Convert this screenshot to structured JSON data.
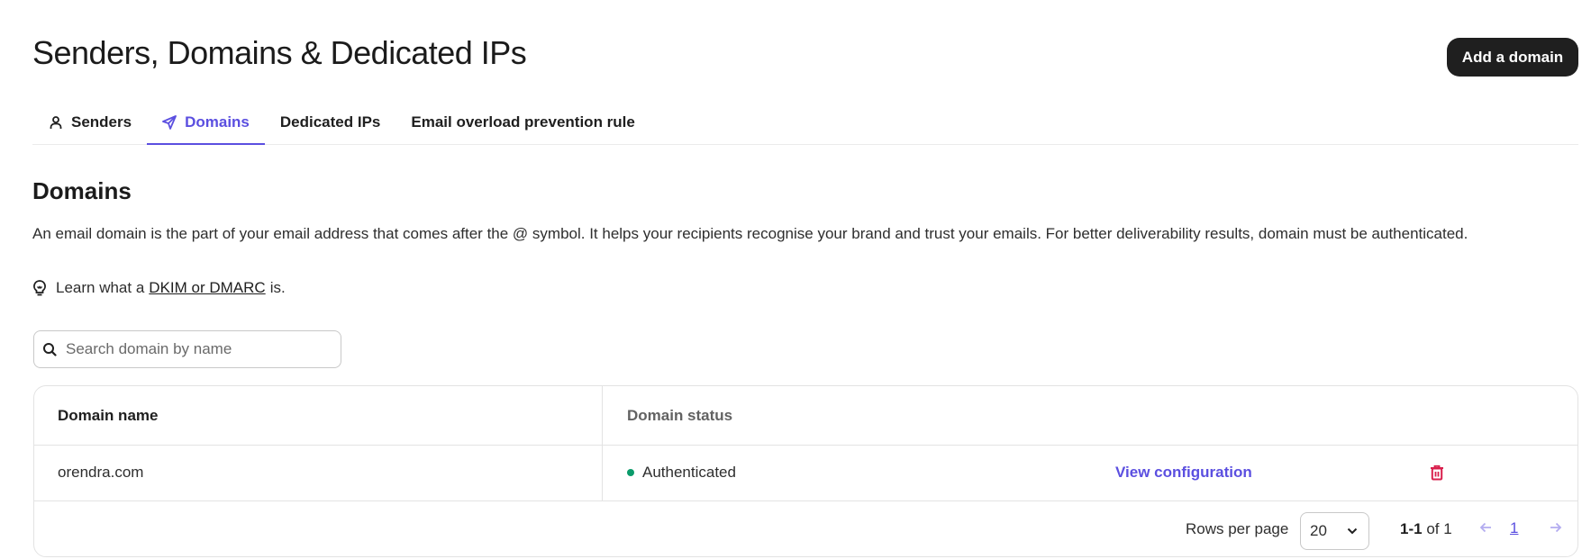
{
  "header": {
    "title": "Senders, Domains & Dedicated IPs",
    "add_button_label": "Add a domain"
  },
  "tabs": [
    {
      "label": "Senders",
      "icon": "user-icon",
      "active": false
    },
    {
      "label": "Domains",
      "icon": "send-icon",
      "active": true
    },
    {
      "label": "Dedicated IPs",
      "active": false
    },
    {
      "label": "Email overload prevention rule",
      "active": false
    }
  ],
  "section": {
    "title": "Domains",
    "description": "An email domain is the part of your email address that comes after the @ symbol. It helps your recipients recognise your brand and trust your emails. For better deliverability results, domain must be authenticated.",
    "learn": {
      "icon": "lightbulb-icon",
      "prefix": "Learn what a",
      "link_text": "DKIM or DMARC",
      "suffix": "is."
    }
  },
  "search": {
    "icon": "search-icon",
    "value": "",
    "placeholder": "Search domain by name"
  },
  "table": {
    "columns": [
      "Domain name",
      "Domain status"
    ],
    "rows": [
      {
        "domain": "orendra.com",
        "status": "Authenticated",
        "status_color": "#0b9b6b",
        "action_label": "View configuration",
        "delete_icon": "trash-icon"
      }
    ]
  },
  "pagination": {
    "rows_per_page_label": "Rows per page",
    "rows_per_page_value": "20",
    "range": "1-1",
    "of_label": "of",
    "total": "1",
    "current_page": "1"
  },
  "colors": {
    "accent": "#5b4fe0",
    "danger": "#d91f4c",
    "success": "#0b9b6b",
    "primary_button": "#1f1f1f"
  }
}
